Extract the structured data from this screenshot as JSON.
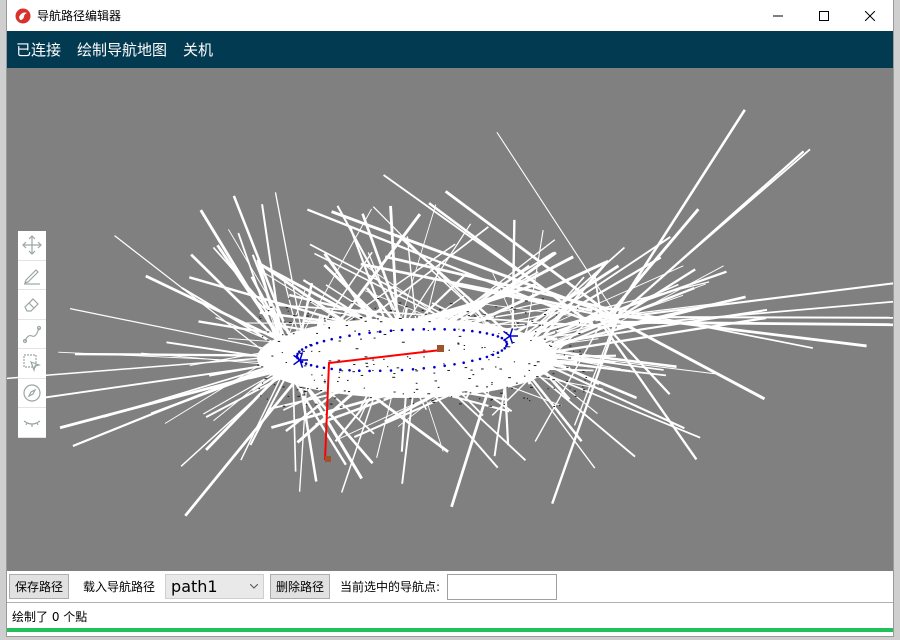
{
  "window": {
    "title": "导航路径编辑器",
    "icon": "app-logo-icon"
  },
  "menu": {
    "items": [
      {
        "label": "已连接"
      },
      {
        "label": "绘制导航地图"
      },
      {
        "label": "关机"
      }
    ]
  },
  "toolbox": {
    "tools": [
      {
        "icon": "move-icon"
      },
      {
        "icon": "pencil-icon"
      },
      {
        "icon": "eraser-icon"
      },
      {
        "icon": "path-draw-icon"
      },
      {
        "icon": "select-icon"
      },
      {
        "icon": "compass-icon"
      },
      {
        "icon": "eye-closed-icon"
      }
    ]
  },
  "controls": {
    "save_label": "保存路径",
    "load_label": "载入导航路径",
    "path_select_value": "path1",
    "delete_label": "删除路径",
    "current_point_label": "当前选中的导航点:",
    "current_point_value": ""
  },
  "status": {
    "text": "绘制了 0 个點"
  },
  "progress": {
    "fraction": 1.0
  },
  "colors": {
    "menubar": "#023a51",
    "canvas": "#808080",
    "path_line": "#ff0000",
    "nav_points": "#0000cc",
    "marker": "#a0522d",
    "progress": "#20c05a"
  }
}
